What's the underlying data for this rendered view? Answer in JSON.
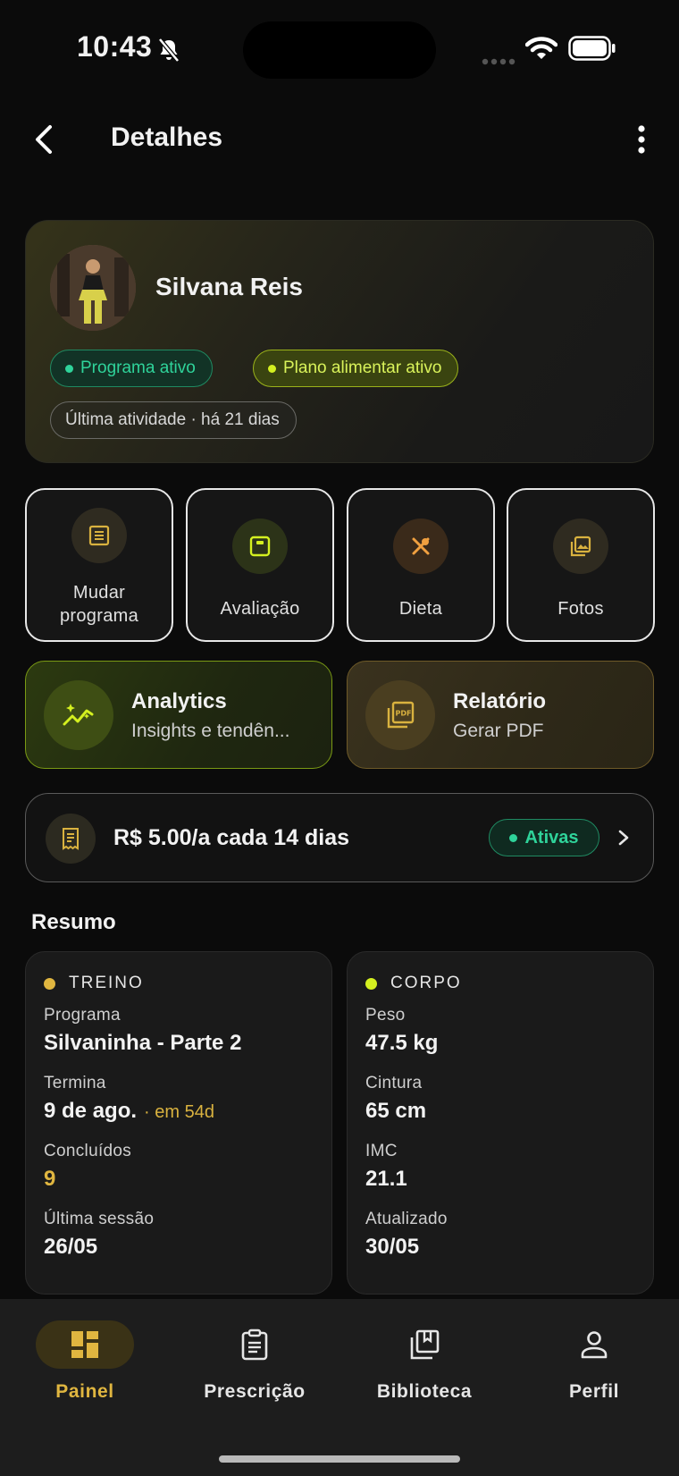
{
  "status_bar": {
    "time": "10:43"
  },
  "header": {
    "title": "Detalhes"
  },
  "profile": {
    "name": "Silvana Reis",
    "chips": {
      "program": "Programa ativo",
      "diet": "Plano alimentar ativo",
      "activity": "Última atividade · há 21 dias"
    }
  },
  "actions": {
    "change_program": "Mudar programa",
    "assessment": "Avaliação",
    "diet": "Dieta",
    "photos": "Fotos"
  },
  "analytics": {
    "title": "Analytics",
    "subtitle": "Insights e tendên..."
  },
  "report": {
    "title": "Relatório",
    "subtitle": "Gerar PDF"
  },
  "subscription": {
    "text": "R$ 5.00/a cada 14 dias",
    "badge": "Ativas"
  },
  "summary": {
    "title": "Resumo",
    "training": {
      "heading": "TREINO",
      "program_label": "Programa",
      "program_value": "Silvaninha - Parte 2",
      "ends_label": "Termina",
      "ends_value": "9 de ago.",
      "ends_suffix": "· em 54d",
      "completed_label": "Concluídos",
      "completed_value": "9",
      "last_session_label": "Última sessão",
      "last_session_value": "26/05"
    },
    "body": {
      "heading": "CORPO",
      "weight_label": "Peso",
      "weight_value": "47.5 kg",
      "waist_label": "Cintura",
      "waist_value": "65 cm",
      "bmi_label": "IMC",
      "bmi_value": "21.1",
      "updated_label": "Atualizado",
      "updated_value": "30/05"
    }
  },
  "nav": {
    "panel": "Painel",
    "prescription": "Prescrição",
    "library": "Biblioteca",
    "profile": "Perfil"
  },
  "colors": {
    "accent_gold": "#e0b640",
    "accent_lime": "#d4f020",
    "accent_green": "#2fd39a",
    "background": "#0b0b0b"
  }
}
